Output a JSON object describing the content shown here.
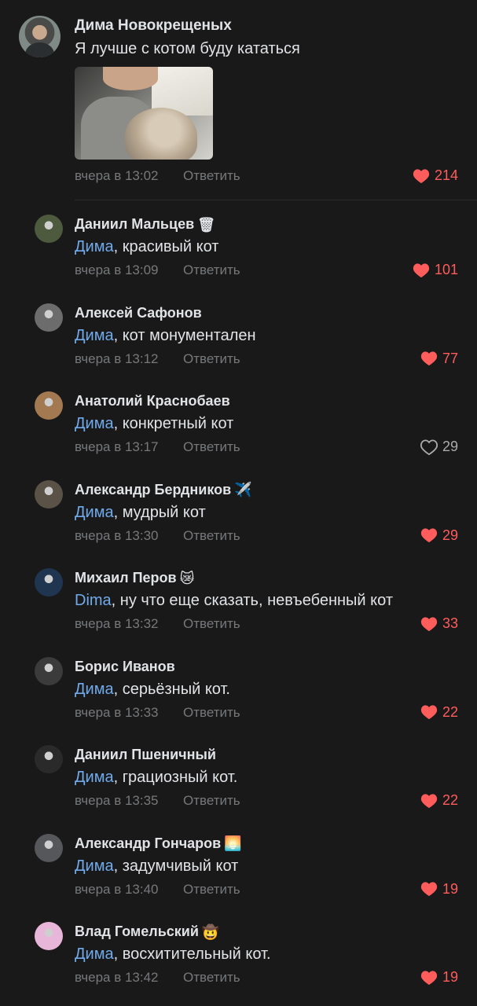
{
  "main_comment": {
    "author": "Дима Новокрещеных",
    "text": "Я лучше с котом буду кататься",
    "time": "вчера в 13:02",
    "reply_label": "Ответить",
    "likes": "214",
    "liked": true
  },
  "replies": [
    {
      "author": "Даниил Мальцев",
      "emoji": "🗑",
      "mention": "Дима",
      "text": ", красивый кот",
      "time": "вчера в 13:09",
      "reply_label": "Ответить",
      "likes": "101",
      "liked": true,
      "avatar_color": "#4d5a3e"
    },
    {
      "author": "Алексей Сафонов",
      "emoji": "",
      "mention": "Дима",
      "text": ", кот монументален",
      "time": "вчера в 13:12",
      "reply_label": "Ответить",
      "likes": "77",
      "liked": true,
      "avatar_color": "#6c6c6c"
    },
    {
      "author": "Анатолий Краснобаев",
      "emoji": "",
      "mention": "Дима",
      "text": ", конкретный кот",
      "time": "вчера в 13:17",
      "reply_label": "Ответить",
      "likes": "29",
      "liked": false,
      "avatar_color": "#a37952"
    },
    {
      "author": "Александр Бердников",
      "emoji": "✈️",
      "mention": "Дима",
      "text": ", мудрый кот",
      "time": "вчера в 13:30",
      "reply_label": "Ответить",
      "likes": "29",
      "liked": true,
      "avatar_color": "#5a5246"
    },
    {
      "author": "Михаил Перов",
      "emoji": "😿",
      "mention": "Dima",
      "text": ", ну что еще сказать, невъебенный кот",
      "time": "вчера в 13:32",
      "reply_label": "Ответить",
      "likes": "33",
      "liked": true,
      "avatar_color": "#1f3550"
    },
    {
      "author": "Борис Иванов",
      "emoji": "",
      "mention": "Дима",
      "text": ", серьёзный кот.",
      "time": "вчера в 13:33",
      "reply_label": "Ответить",
      "likes": "22",
      "liked": true,
      "avatar_color": "#3b3b3b"
    },
    {
      "author": "Даниил Пшеничный",
      "emoji": "",
      "mention": "Дима",
      "text": ", грациозный кот.",
      "time": "вчера в 13:35",
      "reply_label": "Ответить",
      "likes": "22",
      "liked": true,
      "avatar_color": "#2a2a2a"
    },
    {
      "author": "Александр Гончаров",
      "emoji": "🌅",
      "mention": "Дима",
      "text": ",  задумчивый кот",
      "time": "вчера в 13:40",
      "reply_label": "Ответить",
      "likes": "19",
      "liked": true,
      "avatar_color": "#55575a"
    },
    {
      "author": "Влад Гомельский",
      "emoji": "🤠",
      "mention": "Дима",
      "text": ", восхитительный кот.",
      "time": "вчера в 13:42",
      "reply_label": "Ответить",
      "likes": "19",
      "liked": true,
      "avatar_color": "#e7b6d8"
    }
  ],
  "colors": {
    "background": "#19191a",
    "mention": "#71aaeb",
    "liked": "#ff5c5c",
    "meta": "#76787a"
  },
  "icons": {
    "like_filled": "heart-filled-icon",
    "like_outline": "heart-outline-icon"
  }
}
